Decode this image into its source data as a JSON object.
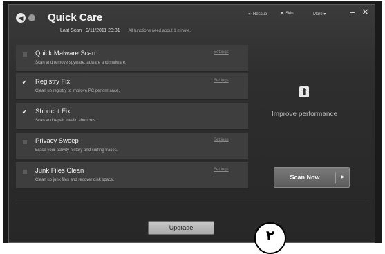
{
  "header": {
    "title": "Quick Care",
    "scan_label": "Last Scan",
    "scan_time": "9/11/2011 20:31",
    "scan_note": "All functions need about 1 minute.",
    "back_icon": "back-arrow-icon",
    "menu": {
      "rescue": "Rescue",
      "skin": "Skin",
      "more": "More"
    },
    "minimize": "–",
    "close": "✕"
  },
  "items": [
    {
      "name": "Quick Malware Scan",
      "desc": "Scan and remove spyware, adware and malware.",
      "checked": false,
      "settings": "Settings"
    },
    {
      "name": "Registry Fix",
      "desc": "Clean up registry to improve PC performance.",
      "checked": true,
      "settings": "Settings"
    },
    {
      "name": "Shortcut Fix",
      "desc": "Scan and repair invalid shortcuts.",
      "checked": true,
      "settings": ""
    },
    {
      "name": "Privacy Sweep",
      "desc": "Erase your activity history and surfing traces.",
      "checked": false,
      "settings": "Settings"
    },
    {
      "name": "Junk Files Clean",
      "desc": "Clean up junk files and recover disk space.",
      "checked": false,
      "settings": "Settings"
    }
  ],
  "side": {
    "improve": "Improve performance",
    "scan_button": "Scan Now"
  },
  "footer": {
    "upgrade": "Upgrade"
  },
  "marker": "٢",
  "colors": {
    "background": "#2e2e2e",
    "item_bg": "#3e3e3e",
    "text": "#f0f0f0"
  }
}
